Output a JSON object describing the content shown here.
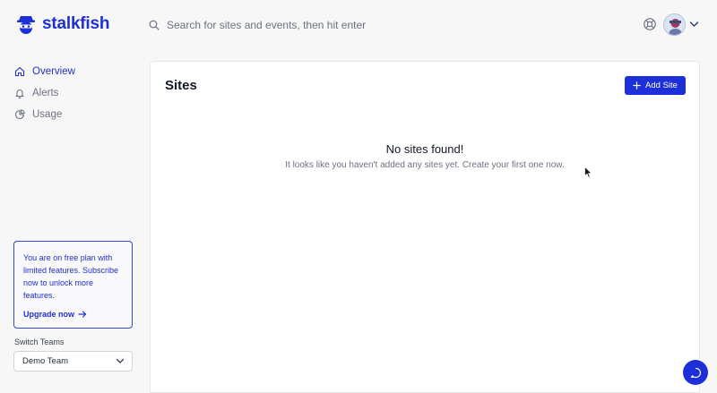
{
  "brand": {
    "name": "stalkfish"
  },
  "search": {
    "placeholder": "Search for sites and events, then hit enter"
  },
  "sidebar": {
    "items": [
      {
        "label": "Overview",
        "icon": "home-icon",
        "active": true
      },
      {
        "label": "Alerts",
        "icon": "bell-icon",
        "active": false
      },
      {
        "label": "Usage",
        "icon": "pie-chart-icon",
        "active": false
      }
    ],
    "plan_notice": "You are on free plan with limited features. Subscribe now to unlock more features.",
    "upgrade_label": "Upgrade now",
    "switch_teams_label": "Switch Teams",
    "team_selected": "Demo Team"
  },
  "main": {
    "title": "Sites",
    "add_button_label": "Add Site",
    "empty_title": "No sites found!",
    "empty_subtitle": "It looks like you haven't added any sites yet. Create your first one now."
  },
  "colors": {
    "accent": "#1d2fd8",
    "background": "#f7f7f8",
    "surface": "#ffffff"
  }
}
